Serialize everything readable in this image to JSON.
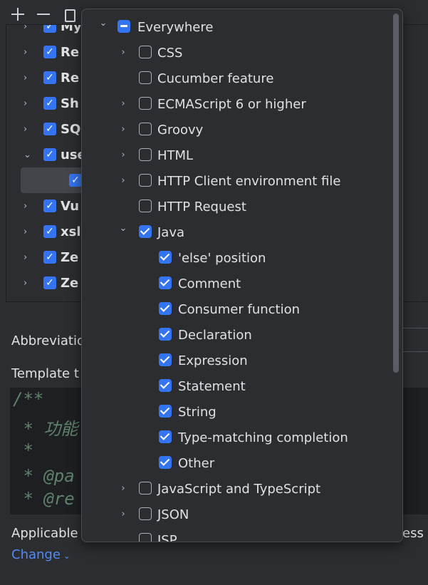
{
  "background": {
    "tree": [
      {
        "label": "My",
        "expanded": false,
        "checked": true
      },
      {
        "label": "Re",
        "expanded": false,
        "checked": true
      },
      {
        "label": "Re",
        "expanded": false,
        "checked": true
      },
      {
        "label": "Sh",
        "expanded": false,
        "checked": true
      },
      {
        "label": "SQ",
        "expanded": false,
        "checked": true
      },
      {
        "label": "use",
        "expanded": true,
        "checked": true
      },
      {
        "label": "",
        "child": true,
        "checked": true
      },
      {
        "label": "Vu",
        "expanded": false,
        "checked": true
      },
      {
        "label": "xsl",
        "expanded": false,
        "checked": true
      },
      {
        "label": "Ze",
        "expanded": false,
        "checked": true
      },
      {
        "label": "Ze",
        "expanded": false,
        "checked": true
      }
    ],
    "abbreviation_label": "Abbreviatio",
    "template_label": "Template t",
    "editor_lines": [
      "/**",
      " * 功能",
      " *",
      " * @pa",
      " * @re"
    ],
    "applicable_label": "Applicable",
    "express_fragment": "ress",
    "change_link": "Change"
  },
  "popup": {
    "items": [
      {
        "label": "Everywhere",
        "level": 0,
        "expander": "down",
        "state": "partial"
      },
      {
        "label": "CSS",
        "level": 1,
        "expander": "right",
        "state": "off"
      },
      {
        "label": "Cucumber feature",
        "level": 1,
        "expander": "none",
        "state": "off"
      },
      {
        "label": "ECMAScript 6 or higher",
        "level": 1,
        "expander": "right",
        "state": "off"
      },
      {
        "label": "Groovy",
        "level": 1,
        "expander": "right",
        "state": "off"
      },
      {
        "label": "HTML",
        "level": 1,
        "expander": "right",
        "state": "off"
      },
      {
        "label": "HTTP Client environment file",
        "level": 1,
        "expander": "right",
        "state": "off"
      },
      {
        "label": "HTTP Request",
        "level": 1,
        "expander": "none",
        "state": "off"
      },
      {
        "label": "Java",
        "level": 1,
        "expander": "down",
        "state": "on"
      },
      {
        "label": "'else' position",
        "level": 2,
        "expander": "none",
        "state": "on"
      },
      {
        "label": "Comment",
        "level": 2,
        "expander": "none",
        "state": "on"
      },
      {
        "label": "Consumer function",
        "level": 2,
        "expander": "none",
        "state": "on"
      },
      {
        "label": "Declaration",
        "level": 2,
        "expander": "none",
        "state": "on"
      },
      {
        "label": "Expression",
        "level": 2,
        "expander": "none",
        "state": "on"
      },
      {
        "label": "Statement",
        "level": 2,
        "expander": "none",
        "state": "on"
      },
      {
        "label": "String",
        "level": 2,
        "expander": "none",
        "state": "on"
      },
      {
        "label": "Type-matching completion",
        "level": 2,
        "expander": "none",
        "state": "on"
      },
      {
        "label": "Other",
        "level": 2,
        "expander": "none",
        "state": "on"
      },
      {
        "label": "JavaScript and TypeScript",
        "level": 1,
        "expander": "right",
        "state": "off"
      },
      {
        "label": "JSON",
        "level": 1,
        "expander": "right",
        "state": "off"
      },
      {
        "label": "JSP",
        "level": 1,
        "expander": "none",
        "state": "off"
      }
    ]
  }
}
